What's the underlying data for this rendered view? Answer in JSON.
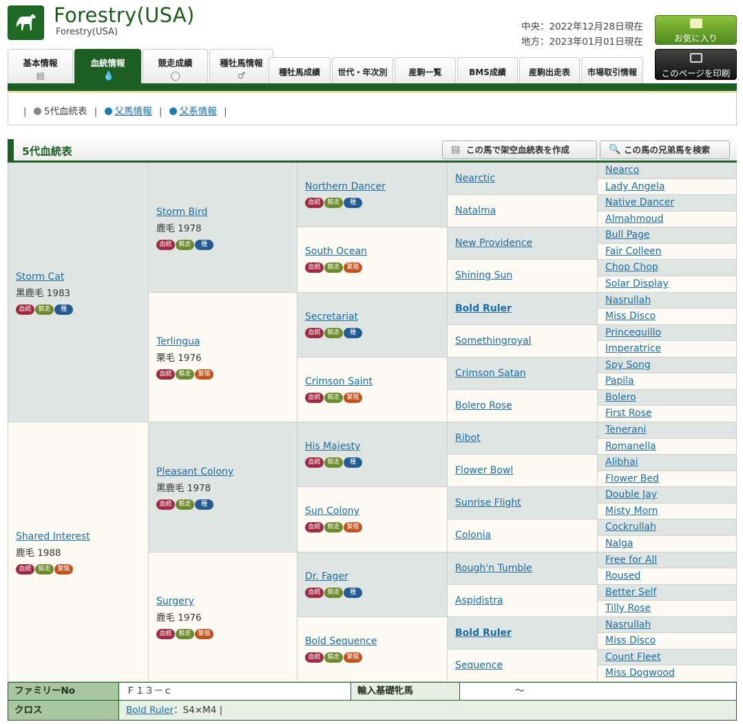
{
  "header": {
    "title": "Forestry(USA)",
    "subtitle": "Forestry(USA)",
    "date_central": "中央：2022年12月28日現在",
    "date_local": "地方：2023年01月01日現在",
    "favorite_label": "お気に入り",
    "print_label": "このページを印刷"
  },
  "tabs": [
    {
      "label": "基本情報",
      "icon": "document-icon"
    },
    {
      "label": "血統情報",
      "icon": "drop-icon"
    },
    {
      "label": "競走成績",
      "icon": "track-icon"
    },
    {
      "label": "種牡馬情報",
      "icon": "stallion-icon"
    },
    {
      "label": "種牡馬成績"
    },
    {
      "label": "世代・年次別"
    },
    {
      "label": "産駒一覧"
    },
    {
      "label": "BMS成績"
    },
    {
      "label": "産駒出走表"
    },
    {
      "label": "市場取引情報"
    }
  ],
  "subnav": {
    "current": "5代血統表",
    "sire_info": "父馬情報",
    "line_info": "父系情報"
  },
  "section": {
    "title": "5代血統表",
    "virtual_pedigree": "この馬で架空血統表を作成",
    "siblings_search": "この馬の兄弟馬を検索"
  },
  "badge_labels": {
    "pedigree": "血統",
    "race": "競走",
    "stallion": "種",
    "breeding": "繁殖"
  },
  "pedigree": {
    "g1": [
      {
        "name": "Storm Cat",
        "coat": "黒鹿毛 1983",
        "badges": [
          "pedigree",
          "race",
          "stallion"
        ]
      },
      {
        "name": "Shared Interest",
        "coat": "鹿毛 1988",
        "badges": [
          "pedigree",
          "race",
          "breeding"
        ]
      }
    ],
    "g2": [
      {
        "name": "Storm Bird",
        "coat": "鹿毛 1978",
        "badges": [
          "pedigree",
          "race",
          "stallion"
        ]
      },
      {
        "name": "Terlingua",
        "coat": "栗毛 1976",
        "badges": [
          "pedigree",
          "race",
          "breeding"
        ]
      },
      {
        "name": "Pleasant Colony",
        "coat": "黒鹿毛 1978",
        "badges": [
          "pedigree",
          "race",
          "stallion"
        ]
      },
      {
        "name": "Surgery",
        "coat": "鹿毛 1976",
        "badges": [
          "pedigree",
          "race",
          "breeding"
        ]
      }
    ],
    "g3": [
      {
        "name": "Northern Dancer",
        "badges": [
          "pedigree",
          "race",
          "stallion"
        ]
      },
      {
        "name": "South Ocean",
        "badges": [
          "pedigree",
          "race",
          "breeding"
        ]
      },
      {
        "name": "Secretariat",
        "badges": [
          "pedigree",
          "race",
          "stallion"
        ]
      },
      {
        "name": "Crimson Saint",
        "badges": [
          "pedigree",
          "race",
          "breeding"
        ]
      },
      {
        "name": "His Majesty",
        "badges": [
          "pedigree",
          "race",
          "stallion"
        ]
      },
      {
        "name": "Sun Colony",
        "badges": [
          "pedigree",
          "race",
          "breeding"
        ]
      },
      {
        "name": "Dr. Fager",
        "badges": [
          "pedigree",
          "race",
          "stallion"
        ]
      },
      {
        "name": "Bold Sequence",
        "badges": [
          "pedigree",
          "race",
          "breeding"
        ]
      }
    ],
    "g4": [
      {
        "name": "Nearctic"
      },
      {
        "name": "Natalma"
      },
      {
        "name": "New Providence"
      },
      {
        "name": "Shining Sun"
      },
      {
        "name": "Bold Ruler",
        "bold": true
      },
      {
        "name": "Somethingroyal"
      },
      {
        "name": "Crimson Satan"
      },
      {
        "name": "Bolero Rose"
      },
      {
        "name": "Ribot"
      },
      {
        "name": "Flower Bowl"
      },
      {
        "name": "Sunrise Flight"
      },
      {
        "name": "Colonia"
      },
      {
        "name": "Rough'n Tumble"
      },
      {
        "name": "Aspidistra"
      },
      {
        "name": "Bold Ruler",
        "bold": true
      },
      {
        "name": "Sequence"
      }
    ],
    "g5": [
      "Nearco",
      "Lady Angela",
      "Native Dancer",
      "Almahmoud",
      "Bull Page",
      "Fair Colleen",
      "Chop Chop",
      "Solar Display",
      "Nasrullah",
      "Miss Disco",
      "Princequillo",
      "Imperatrice",
      "Spy Song",
      "Papila",
      "Bolero",
      "First Rose",
      "Tenerani",
      "Romanella",
      "Alibhai",
      "Flower Bed",
      "Double Jay",
      "Misty Morn",
      "Cockrullah",
      "Nalga",
      "Free for All",
      "Roused",
      "Better Self",
      "Tilly Rose",
      "Nasrullah",
      "Miss Disco",
      "Count Fleet",
      "Miss Dogwood"
    ]
  },
  "footer": {
    "family_label": "ファミリーNo",
    "family_value": "Ｆ１３－ｃ",
    "import_label": "輸入基礎牝馬",
    "import_value": "～",
    "cross_label": "クロス",
    "cross_horse": "Bold Ruler",
    "cross_value": "：S4×M4 |"
  }
}
